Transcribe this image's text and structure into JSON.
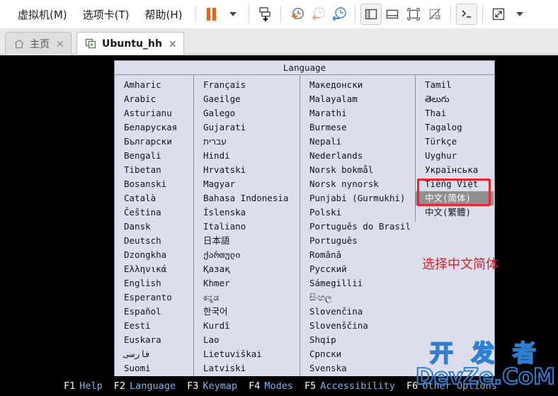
{
  "window": {
    "menus": [
      {
        "label": "虚拟机(M)",
        "name": "menu-virtual-machine"
      },
      {
        "label": "选项卡(T)",
        "name": "menu-tabs"
      },
      {
        "label": "帮助(H)",
        "name": "menu-help"
      }
    ],
    "toolbar": {
      "pause": "pause-icon",
      "pause_dropdown": "caret-down-icon",
      "snapshot": "snapshot-icon",
      "take_snapshot": "take-snapshot-icon",
      "revert_snapshot": "revert-snapshot-icon",
      "snapshot_manager": "snapshot-manager-icon",
      "show_library": "show-library-icon",
      "show_thumbnails": "show-thumbnail-bar-icon",
      "full_screen": "full-screen-icon",
      "unity_mode": "unity-mode-icon",
      "console": "console-icon",
      "stretch": "stretch-icon",
      "stretch_dropdown": "caret-down-icon"
    }
  },
  "tabs": [
    {
      "label": "主页",
      "icon": "home-icon",
      "close": "✕",
      "active": false
    },
    {
      "label": "Ubuntu_hh",
      "icon": "vm-running-icon",
      "close": "✕",
      "active": true
    }
  ],
  "dialog": {
    "title": "Language",
    "columns": [
      {
        "name": "language-column-1",
        "items": [
          "Amharic",
          "Arabic",
          "Asturianu",
          "Беларуская",
          "Български",
          "Bengali",
          "Tibetan",
          "Bosanski",
          "Català",
          "Čeština",
          "Dansk",
          "Deutsch",
          "Dzongkha",
          "Ελληνικά",
          "English",
          "Esperanto",
          "Español",
          "Eesti",
          "Euskara",
          "فارسی",
          "Suomi"
        ]
      },
      {
        "name": "language-column-2",
        "items": [
          "Français",
          "Gaeilge",
          "Galego",
          "Gujarati",
          "עברית",
          "Hindi",
          "Hrvatski",
          "Magyar",
          "Bahasa Indonesia",
          "Íslenska",
          "Italiano",
          "日本語",
          "ქართული",
          "Қазақ",
          "Khmer",
          "ಕನ್ನಡ",
          "한국어",
          "Kurdî",
          "Lao",
          "Lietuviškai",
          "Latviski"
        ]
      },
      {
        "name": "language-column-3",
        "items": [
          "Македонски",
          "Malayalam",
          "Marathi",
          "Burmese",
          "Nepali",
          "Nederlands",
          "Norsk bokmål",
          "Norsk nynorsk",
          "Punjabi (Gurmukhi)",
          "Polski",
          "Português do Brasil",
          "Português",
          "Română",
          "Русский",
          "Sámegillii",
          "සිංහල",
          "Slovenčina",
          "Slovenščina",
          "Shqip",
          "Српски",
          "Svenska"
        ]
      },
      {
        "name": "language-column-4",
        "items": [
          "Tamil",
          "తెలుగు",
          "Thai",
          "Tagalog",
          "Türkçe",
          "Uyghur",
          "Українська",
          "Tiếng Việt",
          "中文(简体)",
          "中文(繁體)"
        ]
      }
    ],
    "selected": "中文(简体)",
    "selected_column": 3,
    "selected_index": 8
  },
  "annotation": {
    "text": "选择中文简体",
    "color": "#e31b22",
    "box_color": "#f2232c"
  },
  "function_bar": [
    {
      "key": "F1",
      "value": "Help"
    },
    {
      "key": "F2",
      "value": "Language"
    },
    {
      "key": "F3",
      "value": "Keymap"
    },
    {
      "key": "F4",
      "value": "Modes"
    },
    {
      "key": "F5",
      "value": "Accessibility"
    },
    {
      "key": "F6",
      "value": "Other Options"
    }
  ],
  "watermark": {
    "line1": "开 发 者",
    "line2": "DevZe.CoM",
    "color": "#2f7fd0"
  }
}
